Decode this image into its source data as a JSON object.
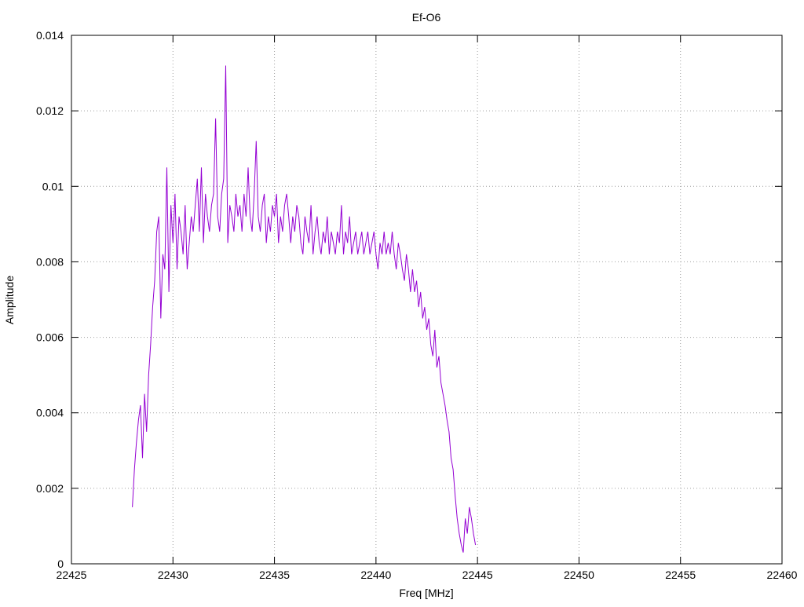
{
  "chart_data": {
    "type": "line",
    "title": "Ef-O6",
    "xlabel": "Freq [MHz]",
    "ylabel": "Amplitude",
    "xlim": [
      22425,
      22460
    ],
    "ylim": [
      0,
      0.014
    ],
    "x_ticks": [
      22425,
      22430,
      22435,
      22440,
      22445,
      22450,
      22455,
      22460
    ],
    "x_tick_labels": [
      "22425",
      "22430",
      "22435",
      "22440",
      "22445",
      "22450",
      "22455",
      "22460"
    ],
    "y_ticks": [
      0,
      0.002,
      0.004,
      0.006,
      0.008,
      0.01,
      0.012,
      0.014
    ],
    "y_tick_labels": [
      "0",
      "0.002",
      "0.004",
      "0.006",
      "0.008",
      "0.01",
      "0.012",
      "0.014"
    ],
    "grid": true,
    "grid_style": "dotted",
    "legend": false,
    "series_color": "#9400d3",
    "series": [
      {
        "x_start": 22428.0,
        "x_step": 0.1,
        "values": [
          0.0015,
          0.0025,
          0.0032,
          0.0038,
          0.0042,
          0.0028,
          0.0045,
          0.0035,
          0.005,
          0.0058,
          0.0068,
          0.0075,
          0.0088,
          0.0092,
          0.0065,
          0.0082,
          0.0078,
          0.0105,
          0.0072,
          0.0095,
          0.0085,
          0.0098,
          0.0078,
          0.0092,
          0.0088,
          0.0082,
          0.0095,
          0.0078,
          0.0085,
          0.0092,
          0.0088,
          0.0095,
          0.0102,
          0.0088,
          0.0105,
          0.0085,
          0.0098,
          0.0092,
          0.0088,
          0.0095,
          0.0098,
          0.0118,
          0.0092,
          0.0088,
          0.0098,
          0.0102,
          0.0132,
          0.0085,
          0.0095,
          0.0092,
          0.0088,
          0.0098,
          0.0092,
          0.0095,
          0.0088,
          0.0098,
          0.0092,
          0.0105,
          0.0092,
          0.0088,
          0.0098,
          0.0112,
          0.0092,
          0.0088,
          0.0095,
          0.0098,
          0.0085,
          0.0092,
          0.0088,
          0.0095,
          0.0092,
          0.0098,
          0.0085,
          0.0092,
          0.0088,
          0.0095,
          0.0098,
          0.0092,
          0.0085,
          0.0092,
          0.0088,
          0.0095,
          0.0092,
          0.0085,
          0.0082,
          0.0092,
          0.0088,
          0.0085,
          0.0095,
          0.0082,
          0.0088,
          0.0092,
          0.0085,
          0.0082,
          0.0088,
          0.0085,
          0.0092,
          0.0082,
          0.0088,
          0.0085,
          0.0082,
          0.0088,
          0.0085,
          0.0095,
          0.0082,
          0.0088,
          0.0085,
          0.0092,
          0.0082,
          0.0085,
          0.0088,
          0.0082,
          0.0085,
          0.0088,
          0.0082,
          0.0085,
          0.0088,
          0.0082,
          0.0085,
          0.0088,
          0.0082,
          0.0078,
          0.0085,
          0.0082,
          0.0088,
          0.0082,
          0.0085,
          0.0082,
          0.0088,
          0.0082,
          0.0078,
          0.0085,
          0.0082,
          0.0078,
          0.0075,
          0.0082,
          0.0078,
          0.0072,
          0.0078,
          0.0072,
          0.0075,
          0.0068,
          0.0072,
          0.0065,
          0.0068,
          0.0062,
          0.0065,
          0.0058,
          0.0055,
          0.0062,
          0.0052,
          0.0055,
          0.0048,
          0.0045,
          0.0042,
          0.0038,
          0.0035,
          0.0028,
          0.0025,
          0.0018,
          0.0012,
          0.0008,
          0.0005,
          0.0003,
          0.0012,
          0.0008,
          0.0015,
          0.0012,
          0.0008,
          0.0005
        ]
      }
    ]
  }
}
